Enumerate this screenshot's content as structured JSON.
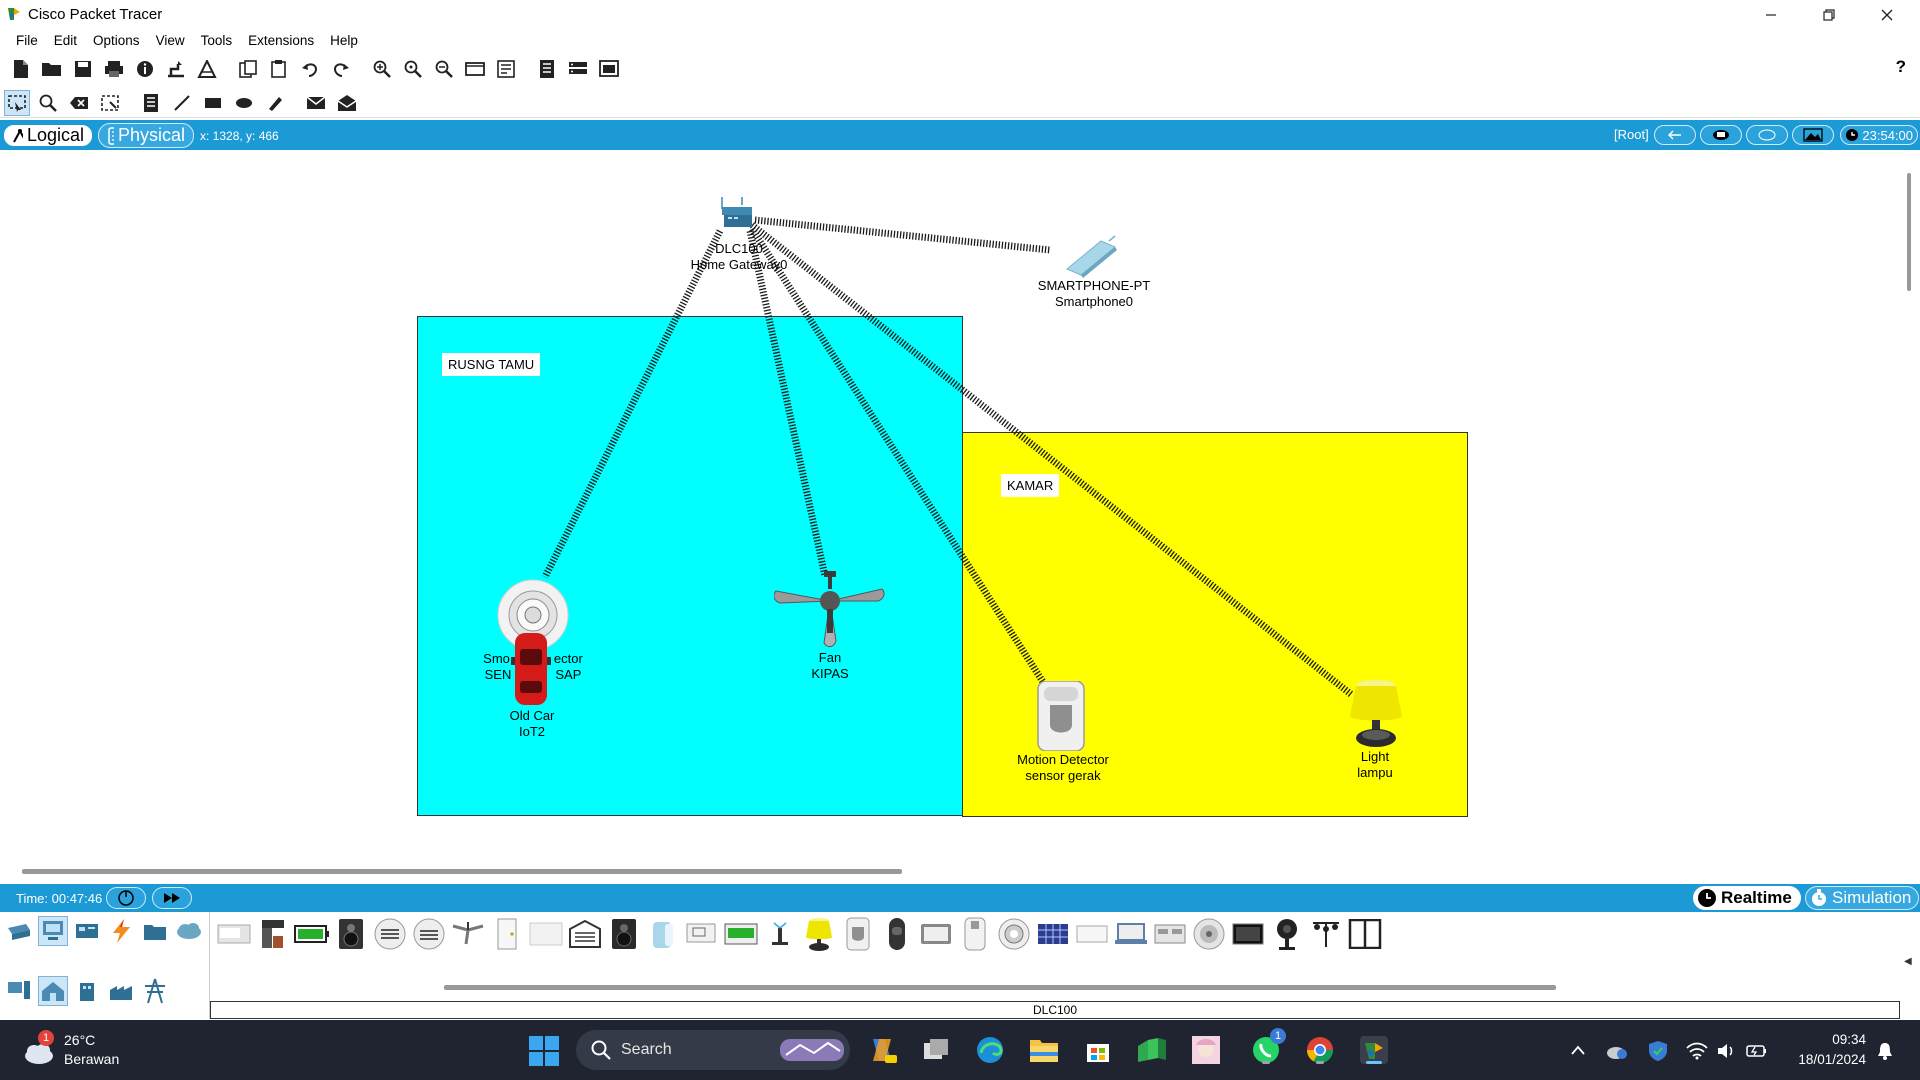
{
  "window": {
    "title": "Cisco Packet Tracer"
  },
  "menu": [
    "File",
    "Edit",
    "Options",
    "View",
    "Tools",
    "Extensions",
    "Help"
  ],
  "help_label": "?",
  "workspace": {
    "tab_logical": "Logical",
    "tab_physical": "Physical",
    "coords": "x: 1328, y: 466",
    "root": "[Root]",
    "clock": "23:54:00"
  },
  "zones": [
    {
      "label": "RUSNG TAMU",
      "color": "#00ffff"
    },
    {
      "label": "KAMAR",
      "color": "#ffff00"
    }
  ],
  "devices": {
    "gateway": {
      "model": "DLC100",
      "name": "Home Gateway0"
    },
    "smartphone": {
      "model": "SMARTPHONE-PT",
      "name": "Smartphone0"
    },
    "smoke": {
      "model_a": "Smo",
      "model_b": "ector",
      "name_a": "SEN",
      "name_b": "SAP"
    },
    "car": {
      "model": "Old Car",
      "name": "IoT2"
    },
    "fan": {
      "model": "Fan",
      "name": "KIPAS"
    },
    "motion": {
      "model": "Motion Detector",
      "name": "sensor gerak"
    },
    "light": {
      "model": "Light",
      "name": "lampu"
    }
  },
  "status_bar": {
    "time": "Time: 00:47:46",
    "realtime": "Realtime",
    "simulation": "Simulation"
  },
  "palette": {
    "selected_device": "DLC100"
  },
  "taskbar": {
    "weather_temp": "26°C",
    "weather_desc": "Berawan",
    "weather_badge": "1",
    "search": "Search",
    "whatsapp_badge": "1",
    "time": "09:34",
    "date": "18/01/2024"
  },
  "colors": {
    "accent_blue": "#1c9ad6",
    "zone_cyan": "#00ffff",
    "zone_yellow": "#ffff00",
    "taskbar": "#1f2430"
  }
}
